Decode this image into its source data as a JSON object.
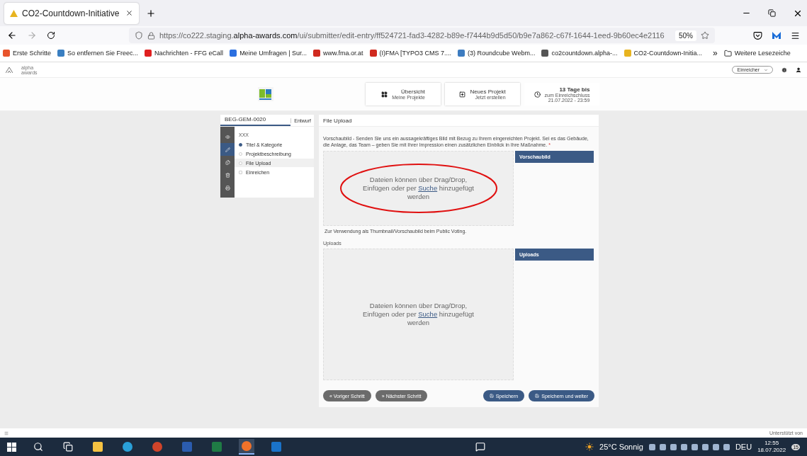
{
  "browser": {
    "tab_title": "CO2-Countdown-Initiative",
    "url": {
      "host": "https://co222.staging.",
      "domain": "alpha-awards.com",
      "path": "/ui/submitter/edit-entry/ff524721-fad3-4282-b89e-f7444b9d5d50/b9e7a862-c67f-1644-1eed-9b60ec4e2116"
    },
    "zoom": "50%",
    "bookmarks": [
      {
        "label": "Erste Schritte",
        "color": "#e8542c"
      },
      {
        "label": "So entfernen Sie Freec...",
        "color": "#3a7fc1"
      },
      {
        "label": "Nachrichten - FFG eCall",
        "color": "#e02020"
      },
      {
        "label": "Meine Umfragen | Sur...",
        "color": "#2b6fe0"
      },
      {
        "label": "www.fma.or.at",
        "color": "#d02a1f"
      },
      {
        "label": "(I)FMA [TYPO3 CMS 7....",
        "color": "#d02a1f"
      },
      {
        "label": "(3) Roundcube Webm...",
        "color": "#3d7cc0"
      },
      {
        "label": "co2countdown.alpha-...",
        "color": "#555555"
      },
      {
        "label": "CO2-Countdown-Initia...",
        "color": "#e8b420"
      }
    ],
    "overflow": "»",
    "more_bookmarks": "Weitere Lesezeiche"
  },
  "app": {
    "brand": "alpha awards",
    "role": "Einreicher",
    "nav": [
      {
        "title": "Übersicht",
        "subtitle": "Meine Projekte"
      },
      {
        "title": "Neues Projekt",
        "subtitle": "Jetzt erstellen"
      }
    ],
    "deadline": {
      "title": "13 Tage bis",
      "subtitle": "zum Einreichschluss",
      "date": "21.07.2022 - 23:59"
    }
  },
  "entry": {
    "id": "BEG-GEM-0020",
    "status": "Entwurf",
    "project": "XXX",
    "tools": [
      {
        "selected": false
      },
      {
        "selected": true
      },
      {
        "selected": false
      },
      {
        "selected": false
      },
      {
        "selected": false
      }
    ],
    "steps": [
      {
        "label": "Titel & Kategorie",
        "kind": "step",
        "done": true,
        "selected": false
      },
      {
        "label": "Projektbeschreibung",
        "kind": "step",
        "done": false,
        "selected": false
      },
      {
        "label": "File Upload",
        "kind": "step",
        "done": false,
        "selected": true
      },
      {
        "label": "Einreichen",
        "kind": "submit",
        "done": false,
        "selected": false
      }
    ]
  },
  "form": {
    "title": "File Upload",
    "description": "Vorschaubild - Senden Sie uns ein aussagekräftiges Bild mit Bezug zu Ihrem eingereichten Projekt. Sei es das Gebäude, die Anlage, das Team – geben Sie mit Ihrer Impression einen zusätzlichen Einblick in Ihre Maßnahme.",
    "required_mark": "*",
    "sections": [
      {
        "drop_before": "Dateien können über Drag/Drop, Einfügen oder per",
        "drop_link": "Suche",
        "drop_after": "hinzugefügt werden",
        "side_title": "Vorschaubild",
        "hint": "Zur Verwendung als Thumbnail/Vorschaubild beim Public Voting.",
        "circled": true
      },
      {
        "label": "Uploads",
        "drop_before": "Dateien können über Drag/Drop, Einfügen oder per",
        "drop_link": "Suche",
        "drop_after": "hinzugefügt werden",
        "side_title": "Uploads",
        "circled": false
      }
    ],
    "buttons": [
      {
        "label": "« Voriger Schritt",
        "kind": "secondary"
      },
      {
        "label": "» Nächster Schritt",
        "kind": "secondary"
      },
      {
        "label": "Speichern",
        "kind": "primary"
      },
      {
        "label": "Speichern und weiter",
        "kind": "primary"
      }
    ]
  },
  "footer": {
    "credit": "Unterstützt von"
  },
  "taskbar": {
    "apps": [
      {
        "kind": "search",
        "selected": false
      },
      {
        "kind": "taskview",
        "selected": false
      },
      {
        "kind": "folder",
        "selected": false
      },
      {
        "kind": "edge",
        "selected": false
      },
      {
        "kind": "powerpoint",
        "selected": false
      },
      {
        "kind": "word",
        "selected": false
      },
      {
        "kind": "excel",
        "selected": false
      },
      {
        "kind": "firefox",
        "selected": true
      },
      {
        "kind": "outlook",
        "selected": false
      }
    ],
    "weather": "25°C Sonnig",
    "language": "DEU",
    "time": "12:55",
    "date": "18.07.2022",
    "notifications": "15"
  }
}
